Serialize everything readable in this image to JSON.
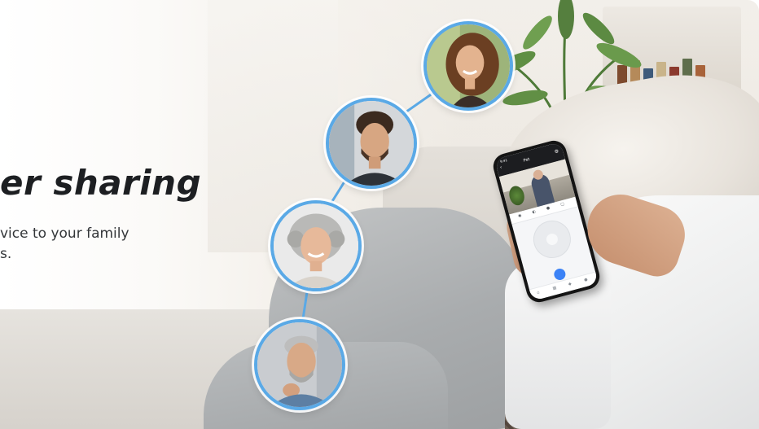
{
  "banner": {
    "headline": "er sharing",
    "subtitle_lines": [
      "vice to your family",
      "s."
    ]
  },
  "phone": {
    "status_time": "9:41",
    "screen_title": "Pet",
    "icons": {
      "back": "back-arrow-icon",
      "settings": "gear-icon",
      "controls": [
        "camera-icon",
        "mute-icon",
        "record-icon",
        "fullscreen-icon"
      ],
      "talk": "microphone-icon",
      "tabs": [
        "home-icon",
        "gallery-icon",
        "alert-icon",
        "profile-icon"
      ]
    }
  },
  "avatars": [
    {
      "id": "young-woman",
      "description": "smiling young woman with curly hair"
    },
    {
      "id": "young-man",
      "description": "young man with dark hair and beard"
    },
    {
      "id": "older-woman",
      "description": "smiling older woman with gray curly hair"
    },
    {
      "id": "older-man",
      "description": "older man with gray hair and beard"
    }
  ],
  "colors": {
    "avatar_ring": "#5aa9e6",
    "headline": "#1d1f22",
    "subtitle": "#333639",
    "accent": "#3b82f6"
  }
}
